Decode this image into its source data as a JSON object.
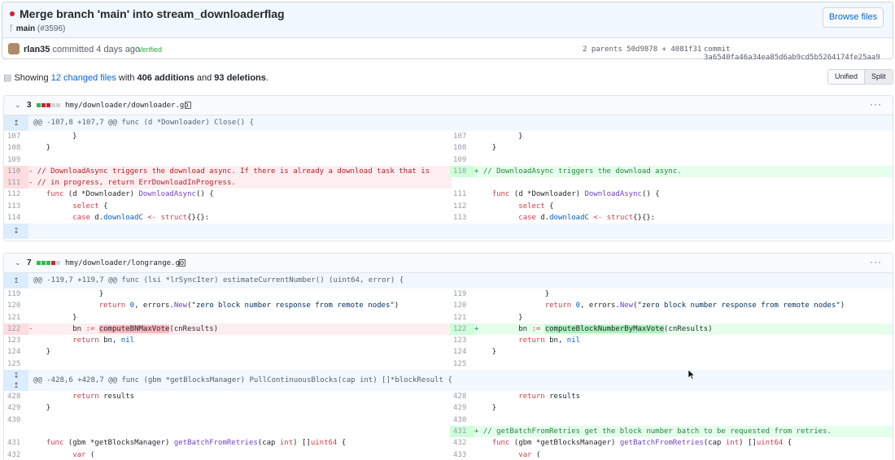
{
  "commit": {
    "title": "Merge branch 'main' into stream_downloaderflag",
    "branch": "main",
    "pr": "(#3596)",
    "browse_label": "Browse files",
    "author": "rlan35",
    "action": "committed 4 days ago",
    "verified": "Verified",
    "parents": "2 parents 50d9878 + 4081f31",
    "sha": "commit 3a6540fa46a34ea85d6ab9cd5b5264174fe25aa9"
  },
  "summary": {
    "prefix": "Showing ",
    "changed": "12 changed files",
    "mid1": " with ",
    "additions": "406 additions",
    "mid2": " and ",
    "deletions": "93 deletions",
    "suffix": ".",
    "unified": "Unified",
    "split": "Split"
  },
  "files": [
    {
      "count": "3",
      "path": "hmy/downloader/downloader.go",
      "hunk": "@@ -107,8 +107,7 @@ func (d *Downloader) Close() {"
    },
    {
      "count": "7",
      "path": "hmy/downloader/longrange.go",
      "hunk1": "@@ -119,7 +119,7 @@ func (lsi *lrSyncIter) estimateCurrentNumber() (uint64, error) {",
      "hunk2": "@@ -428,6 +428,7 @@ func (gbm *getBlocksManager) PullContinuousBlocks(cap int) []*blockResult {"
    }
  ],
  "icons": {
    "expand_up": "↥",
    "expand_down": "↧",
    "more": "···",
    "chevron": "⌄"
  }
}
